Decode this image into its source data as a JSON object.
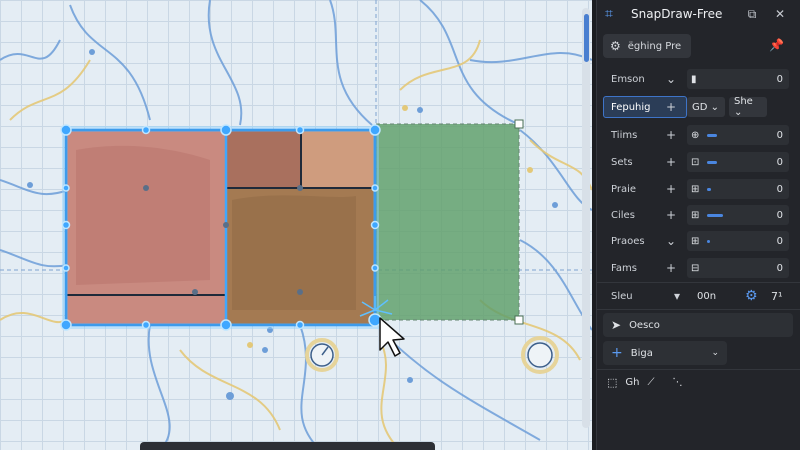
{
  "app": {
    "title": "SnapDraw-Free",
    "preset_label": "ëghing Pre"
  },
  "properties": [
    {
      "label": "Emson",
      "action": "⌄",
      "icon": "▮",
      "value": "0"
    },
    {
      "label": "Fepuhig",
      "action": "+",
      "icon": "",
      "value": "",
      "active": true,
      "chip_a": "GD ⌄",
      "chip_b": "She ⌄"
    },
    {
      "label": "Tiims",
      "action": "+",
      "icon": "⊕",
      "value": "0"
    },
    {
      "label": "Sets",
      "action": "+",
      "icon": "⊡",
      "value": "0"
    },
    {
      "label": "Praie",
      "action": "+",
      "icon": "⊞",
      "value": "0"
    },
    {
      "label": "Ciles",
      "action": "+",
      "icon": "⊞",
      "value": "0"
    },
    {
      "label": "Praoes",
      "action": "⌄",
      "icon": "⊞",
      "value": "0"
    },
    {
      "label": "Fams",
      "action": "+",
      "icon": "⊟",
      "value": "0"
    }
  ],
  "slew": {
    "label": "Sleu",
    "dropdown": "▾",
    "value": "00n",
    "right_value": "7¹"
  },
  "tools": {
    "select_label": "Oesco",
    "add_label": "Biga",
    "bottom_a": "Gh",
    "bottom_b": "⟋",
    "bottom_c": "⋱"
  },
  "colors": {
    "accent": "#4a86e0",
    "shape_red": "#c98a80",
    "shape_green": "#5f9f6a",
    "selection": "#3fa7ff"
  }
}
